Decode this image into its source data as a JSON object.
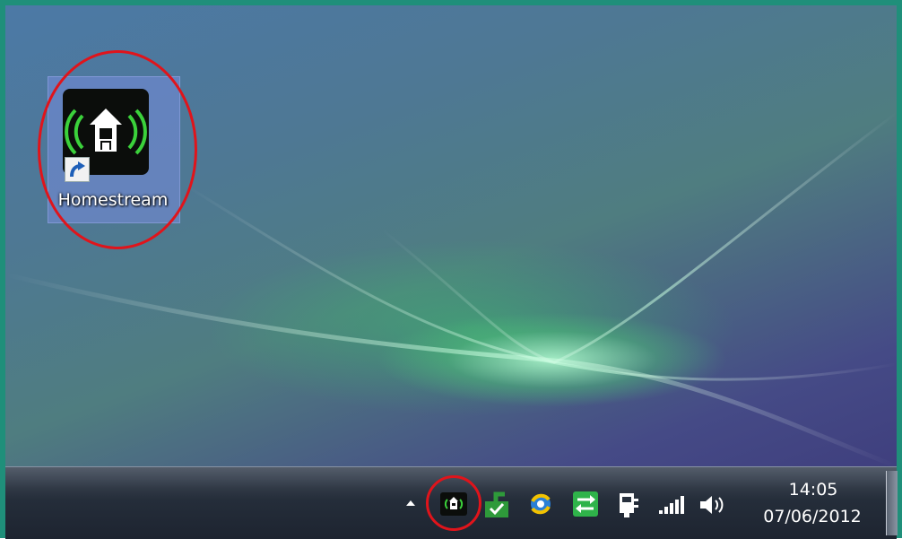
{
  "desktop": {
    "shortcut": {
      "label": "Homestream",
      "icon": "homestream-app-icon"
    }
  },
  "taskbar": {
    "tray": {
      "overflow_icon": "chevron-up-icon",
      "icons": [
        "homestream-tray-icon",
        "network-check-icon",
        "sync-icon",
        "transfer-arrows-icon",
        "power-plug-icon",
        "signal-bars-icon",
        "speaker-volume-icon"
      ]
    },
    "clock": {
      "time": "14:05",
      "date": "07/06/2012"
    }
  },
  "colors": {
    "annotation_ring": "#e0141b",
    "signal_green": "#3bd13b",
    "taskbar": "#1d2430"
  }
}
